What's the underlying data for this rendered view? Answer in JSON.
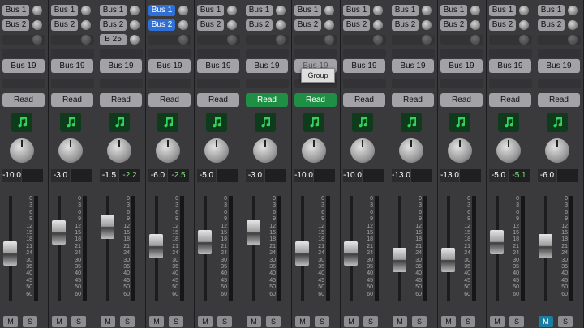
{
  "colors": {
    "blue_send": "#2f6fd6",
    "read_green": "#1f8f45",
    "mute_teal": "#1b7ea0",
    "peak_green": "#7ee37a"
  },
  "icons": {
    "instrument": "music-note-icon"
  },
  "fader_scale": [
    "0",
    "3",
    "6",
    "9",
    "12",
    "15",
    "18",
    "21",
    "24",
    "30",
    "35",
    "40",
    "45",
    "50",
    "60"
  ],
  "tooltip": {
    "label": "Group"
  },
  "strips": [
    {
      "sends": [
        {
          "label": "Bus 1"
        },
        {
          "label": "Bus 2"
        }
      ],
      "output": "Bus 19",
      "automation": "Read",
      "volume": "-10.0",
      "peak": "",
      "fader_level": 0.44,
      "mute": "M",
      "solo": "S"
    },
    {
      "sends": [
        {
          "label": "Bus 1"
        },
        {
          "label": "Bus 2"
        }
      ],
      "output": "Bus 19",
      "automation": "Read",
      "volume": "-3.0",
      "peak": "",
      "fader_level": 0.7,
      "mute": "M",
      "solo": "S"
    },
    {
      "sends": [
        {
          "label": "Bus 1"
        },
        {
          "label": "Bus 2"
        },
        {
          "label": "B 25"
        }
      ],
      "output": "Bus 19",
      "automation": "Read",
      "volume": "-1.5",
      "peak": "-2.2",
      "fader_level": 0.77,
      "mute": "M",
      "solo": "S"
    },
    {
      "sends": [
        {
          "label": "Bus 1",
          "active": true
        },
        {
          "label": "Bus 2",
          "active": true
        }
      ],
      "output": "Bus 19",
      "automation": "Read",
      "volume": "-6.0",
      "peak": "-2.5",
      "fader_level": 0.53,
      "mute": "M",
      "solo": "S"
    },
    {
      "sends": [
        {
          "label": "Bus 1"
        },
        {
          "label": "Bus 2"
        }
      ],
      "output": "Bus 19",
      "automation": "Read",
      "volume": "-5.0",
      "peak": "",
      "fader_level": 0.58,
      "mute": "M",
      "solo": "S"
    },
    {
      "sends": [
        {
          "label": "Bus 1"
        },
        {
          "label": "Bus 2"
        }
      ],
      "output": "Bus 19",
      "automation": "Read",
      "automation_active": true,
      "volume": "-3.0",
      "peak": "",
      "fader_level": 0.7,
      "mute": "M",
      "solo": "S"
    },
    {
      "sends": [
        {
          "label": "Bus 1"
        },
        {
          "label": "Bus 2"
        }
      ],
      "output": "Bus 19",
      "output_faded": true,
      "automation": "Read",
      "automation_active": true,
      "volume": "-10.0",
      "peak": "",
      "fader_level": 0.44,
      "mute": "M",
      "solo": "S"
    },
    {
      "sends": [
        {
          "label": "Bus 1"
        },
        {
          "label": "Bus 2"
        }
      ],
      "output": "Bus 19",
      "automation": "Read",
      "volume": "-10.0",
      "peak": "",
      "fader_level": 0.44,
      "mute": "M",
      "solo": "S"
    },
    {
      "sends": [
        {
          "label": "Bus 1"
        },
        {
          "label": "Bus 2"
        }
      ],
      "output": "Bus 19",
      "automation": "Read",
      "volume": "-13.0",
      "peak": "",
      "fader_level": 0.36,
      "mute": "M",
      "solo": "S"
    },
    {
      "sends": [
        {
          "label": "Bus 1"
        },
        {
          "label": "Bus 2"
        }
      ],
      "output": "Bus 19",
      "automation": "Read",
      "volume": "-13.0",
      "peak": "",
      "fader_level": 0.36,
      "mute": "M",
      "solo": "S"
    },
    {
      "sends": [
        {
          "label": "Bus 1"
        },
        {
          "label": "Bus 2"
        }
      ],
      "output": "Bus 19",
      "automation": "Read",
      "volume": "-5.0",
      "peak": "-5.1",
      "fader_level": 0.58,
      "mute": "M",
      "solo": "S"
    },
    {
      "sends": [
        {
          "label": "Bus 1"
        },
        {
          "label": "Bus 2"
        }
      ],
      "output": "Bus 19",
      "automation": "Read",
      "volume": "-6.0",
      "peak": "",
      "fader_level": 0.53,
      "mute": "M",
      "mute_active": true,
      "solo": "S"
    }
  ]
}
